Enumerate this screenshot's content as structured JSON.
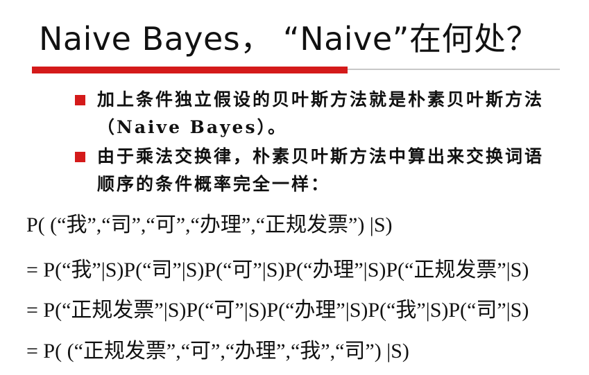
{
  "slide": {
    "title": "Naive Bayes， “Naive”在何处？",
    "bullets": [
      "加上条件独立假设的贝叶斯方法就是朴素贝叶斯方法（Naive Bayes）。",
      "由于乘法交换律，朴素贝叶斯方法中算出来交换词语顺序的条件概率完全一样："
    ],
    "equations": [
      "P( (“我”,“司”,“可”,“办理”,“正规发票”) |S)",
      "= P(“我”|S)P(“司”|S)P(“可”|S)P(“办理”|S)P(“正规发票”|S)",
      "= P(“正规发票”|S)P(“可”|S)P(“办理”|S)P(“我”|S)P(“司”|S)",
      "= P( (“正规发票”,“可”,“办理”,“我”,“司”) |S)"
    ],
    "colors": {
      "accent_red": "#d41a1a",
      "rule_gray": "#c8c8c8",
      "text": "#111111"
    }
  }
}
